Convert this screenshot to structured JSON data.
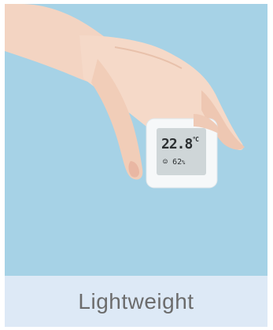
{
  "product_card": {
    "image_alt": "hand holding temperature and humidity monitor",
    "display": {
      "temperature": "22.8",
      "temperature_unit": "°C",
      "humidity": "62",
      "humidity_unit": "%"
    },
    "caption": "Lightweight"
  },
  "colors": {
    "sky_background": "#a6d2e6",
    "caption_background": "#dde9f6",
    "caption_text": "#6c6c6c"
  }
}
